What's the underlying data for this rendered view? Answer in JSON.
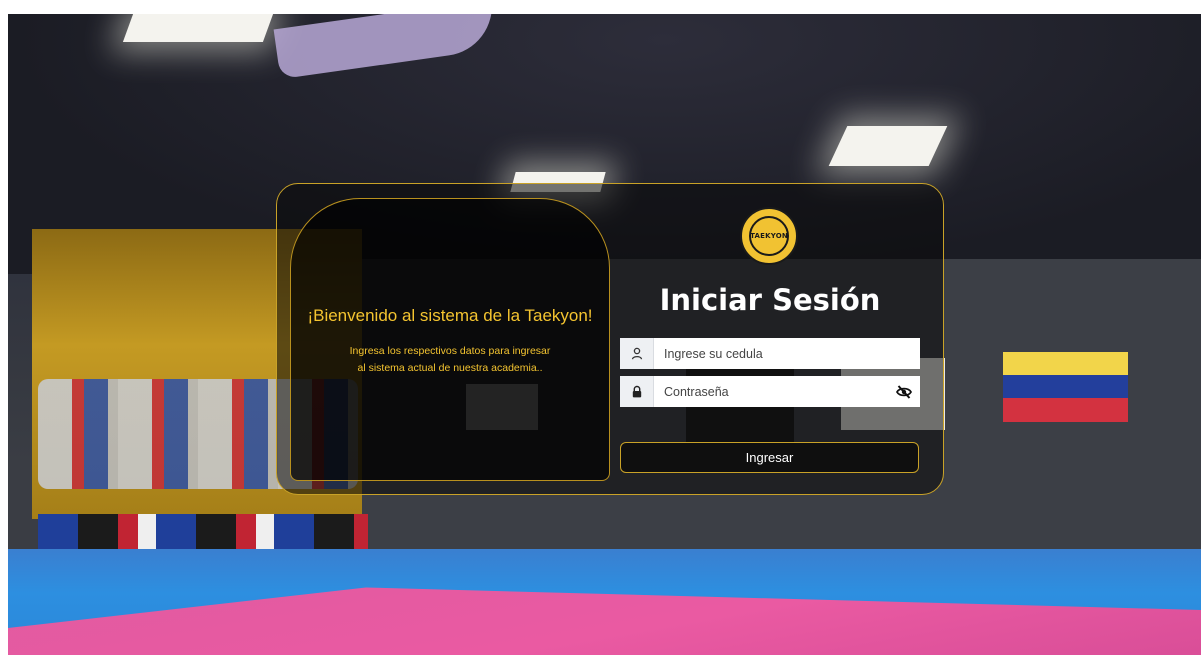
{
  "welcome": {
    "title": "¡Bienvenido al sistema de la Taekyon!",
    "text_line1": "Ingresa los respectivos datos para ingresar",
    "text_line2": "al sistema actual de nuestra academia.."
  },
  "logo": {
    "word": "TAEKYON"
  },
  "login": {
    "title": "Iniciar Sesión",
    "cedula_placeholder": "Ingrese su cedula",
    "cedula_value": "",
    "password_placeholder": "Contraseña",
    "password_value": "",
    "submit_label": "Ingresar"
  },
  "icons": {
    "user_field_icon": "user-icon",
    "password_field_icon": "lock-icon",
    "toggle_visibility_icon": "eye-slash-icon"
  },
  "colors": {
    "accent_gold": "#c9a227",
    "welcome_text": "#f4c430",
    "card_background": "rgba(10,10,10,0.55)",
    "button_background": "#0f0f0f"
  }
}
